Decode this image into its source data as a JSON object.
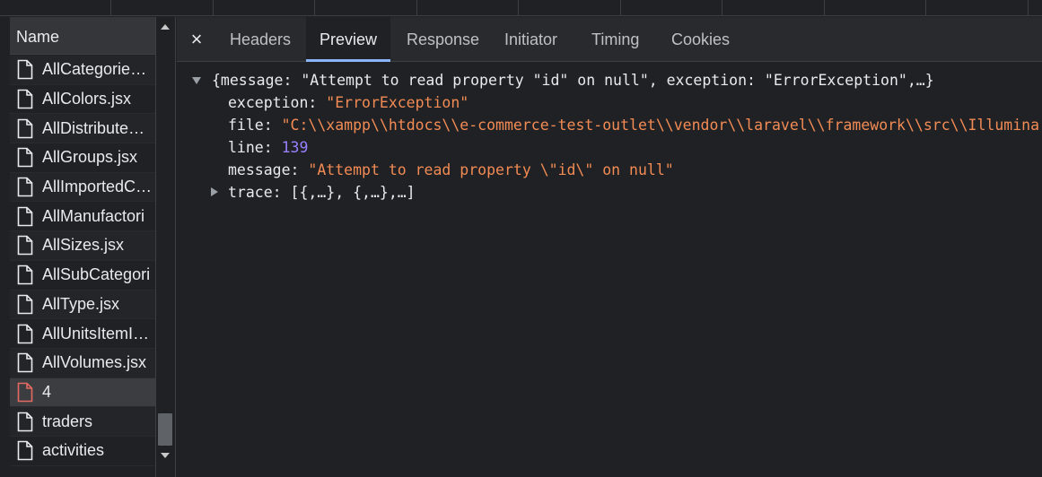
{
  "list": {
    "header": "Name",
    "items": [
      {
        "name": "AllCategories.jsx",
        "status": "ok"
      },
      {
        "name": "AllColors.jsx",
        "status": "ok"
      },
      {
        "name": "AllDistributeC...",
        "status": "ok"
      },
      {
        "name": "AllGroups.jsx",
        "status": "ok"
      },
      {
        "name": "AllImportedCo...",
        "status": "ok"
      },
      {
        "name": "AllManufactori",
        "status": "ok"
      },
      {
        "name": "AllSizes.jsx",
        "status": "ok"
      },
      {
        "name": "AllSubCategori",
        "status": "ok"
      },
      {
        "name": "AllType.jsx",
        "status": "ok"
      },
      {
        "name": "AllUnitsItemId...",
        "status": "ok"
      },
      {
        "name": "AllVolumes.jsx",
        "status": "ok"
      },
      {
        "name": "4",
        "status": "error"
      },
      {
        "name": "traders",
        "status": "ok"
      },
      {
        "name": "activities",
        "status": "ok"
      }
    ]
  },
  "tabs": {
    "close": "×",
    "items": [
      "Headers",
      "Preview",
      "Response",
      "Initiator",
      "Timing",
      "Cookies"
    ],
    "active": "Preview"
  },
  "preview": {
    "summary": "{message: \"Attempt to read property \"id\" on null\", exception: \"ErrorException\",…}",
    "fields": [
      {
        "key": "exception",
        "value": "\"ErrorException\"",
        "type": "string"
      },
      {
        "key": "file",
        "value": "\"C:\\\\xampp\\\\htdocs\\\\e-commerce-test-outlet\\\\vendor\\\\laravel\\\\framework\\\\src\\\\Illumina",
        "type": "string"
      },
      {
        "key": "line",
        "value": "139",
        "type": "number"
      },
      {
        "key": "message",
        "value": "\"Attempt to read property \\\"id\\\" on null\"",
        "type": "string"
      }
    ],
    "trace": {
      "key": "trace",
      "value": "[{,…}, {,…},…]"
    }
  },
  "colors": {
    "background": "#202124",
    "string": "#f28b54",
    "number": "#9980ff",
    "active_tab_underline": "#8ab4f8",
    "error_icon": "#e46962"
  }
}
